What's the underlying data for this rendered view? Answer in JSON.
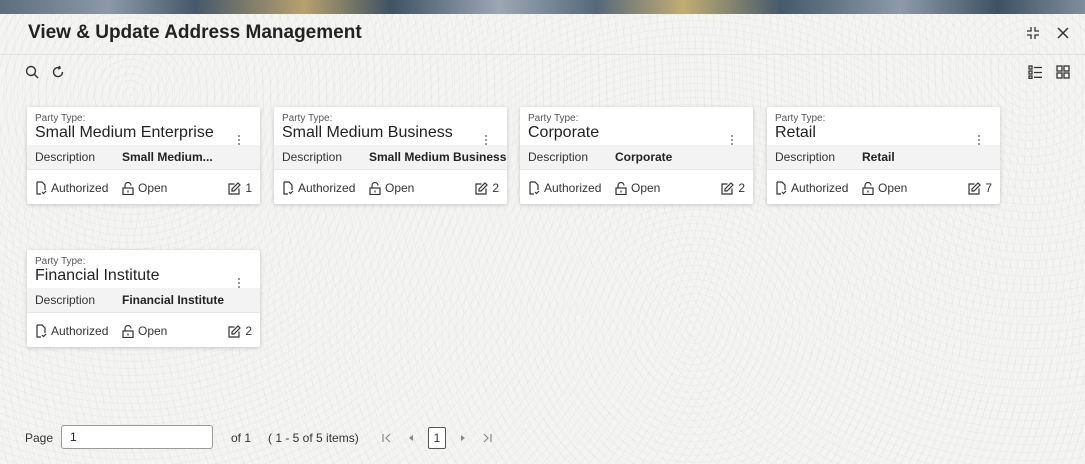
{
  "window": {
    "title": "View & Update Address Management",
    "icons": [
      "minimize-icon",
      "close-icon"
    ]
  },
  "toolbar": {
    "icons": [
      "search-icon",
      "refresh-icon",
      "list-view-icon",
      "grid-view-icon"
    ]
  },
  "cards": [
    {
      "type_label": "Party Type:",
      "name": "Small Medium Enterprise",
      "desc_label": "Description",
      "desc_value": "Small Medium...",
      "status": "Authorized",
      "lock": "Open",
      "version": "1"
    },
    {
      "type_label": "Party Type:",
      "name": "Small Medium Business",
      "desc_label": "Description",
      "desc_value": "Small Medium Business",
      "status": "Authorized",
      "lock": "Open",
      "version": "2"
    },
    {
      "type_label": "Party Type:",
      "name": "Corporate",
      "desc_label": "Description",
      "desc_value": "Corporate",
      "status": "Authorized",
      "lock": "Open",
      "version": "2"
    },
    {
      "type_label": "Party Type:",
      "name": "Retail",
      "desc_label": "Description",
      "desc_value": "Retail",
      "status": "Authorized",
      "lock": "Open",
      "version": "7"
    },
    {
      "type_label": "Party Type:",
      "name": "Financial Institute",
      "desc_label": "Description",
      "desc_value": "Financial Institute",
      "status": "Authorized",
      "lock": "Open",
      "version": "2"
    }
  ],
  "pagination": {
    "page_label": "Page",
    "page_value": "1",
    "of_text": "of 1",
    "range_text": "( 1 - 5 of 5 items)",
    "current_page": "1"
  }
}
